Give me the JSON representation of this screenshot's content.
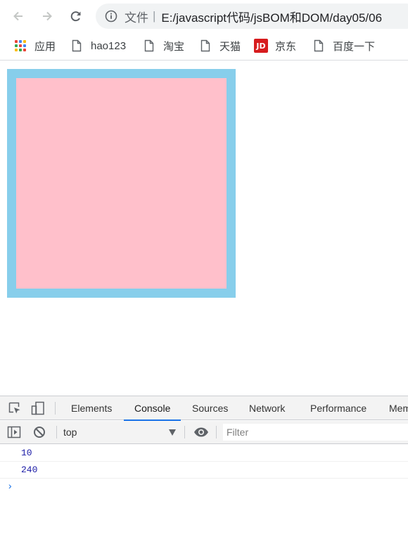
{
  "toolbar": {
    "address": {
      "scheme_label": "文件",
      "separator": "|",
      "url": "E:/javascript代码/jsBOM和DOM/day05/06"
    }
  },
  "bookmarks": [
    {
      "label": "应用",
      "icon": "apps-grid-icon"
    },
    {
      "label": "hao123",
      "icon": "page-icon"
    },
    {
      "label": "淘宝",
      "icon": "page-icon"
    },
    {
      "label": "天猫",
      "icon": "page-icon"
    },
    {
      "label": "京东",
      "icon": "jd-logo",
      "logo_text": "JD"
    },
    {
      "label": "百度一下",
      "icon": "page-icon"
    }
  ],
  "page": {
    "outer_color": "#87ceeb",
    "inner_color": "#ffc0cb"
  },
  "devtools": {
    "tabs": [
      {
        "label": "Elements",
        "active": false
      },
      {
        "label": "Console",
        "active": true
      },
      {
        "label": "Sources",
        "active": false
      },
      {
        "label": "Network",
        "active": false
      },
      {
        "label": "Performance",
        "active": false
      },
      {
        "label": "Mem",
        "active": false
      }
    ],
    "context": "top",
    "filter_placeholder": "Filter",
    "logs": [
      "10",
      "240"
    ],
    "prompt": "›"
  }
}
